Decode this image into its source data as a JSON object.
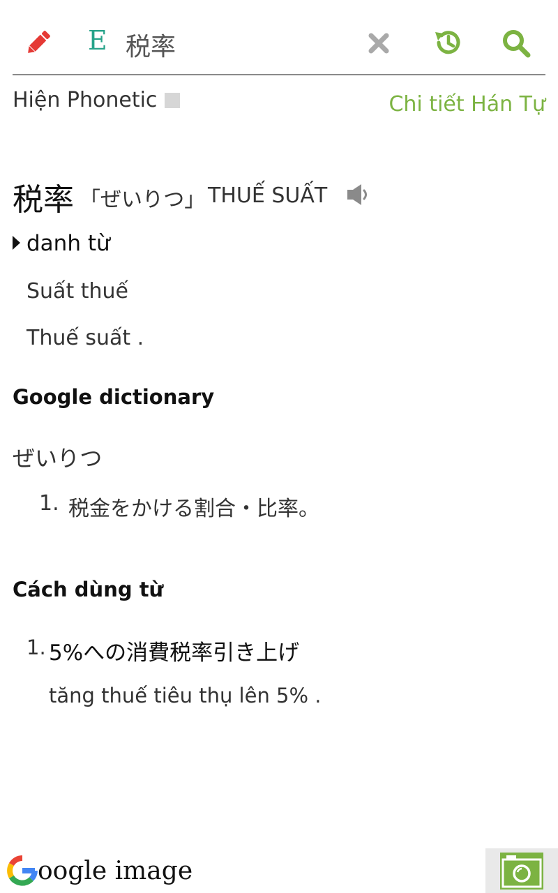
{
  "toolbar": {
    "lang_badge": "E",
    "query": "税率",
    "icons": [
      "pencil-icon",
      "close-icon",
      "history-icon",
      "search-icon"
    ],
    "colors": {
      "pencil": "#e53935",
      "green": "#7cb342",
      "close": "#a9a9a9"
    }
  },
  "phonetic": {
    "label": "Hiện Phonetic",
    "checked": false
  },
  "detail_link": "Chi tiết Hán Tự",
  "entry": {
    "word": "税率",
    "reading": "「ぜいりつ」",
    "hanviet": "THUẾ SUẤT",
    "part_of_speech": "danh từ",
    "meanings": [
      "Suất thuế",
      "Thuế suất ."
    ]
  },
  "google_dictionary": {
    "title": "Google dictionary",
    "reading": "ぜいりつ",
    "definitions": [
      {
        "num": "1.",
        "text": "税金をかける割合・比率。"
      }
    ]
  },
  "usage": {
    "title": "Cách dùng từ",
    "examples": [
      {
        "num": "1.",
        "jp": "5%への消費税率引き上げ",
        "vi": "tăng thuế tiêu thụ lên 5% ."
      }
    ]
  },
  "footer": {
    "google_image_text": "oogle image",
    "camera_icon": "camera-icon"
  }
}
